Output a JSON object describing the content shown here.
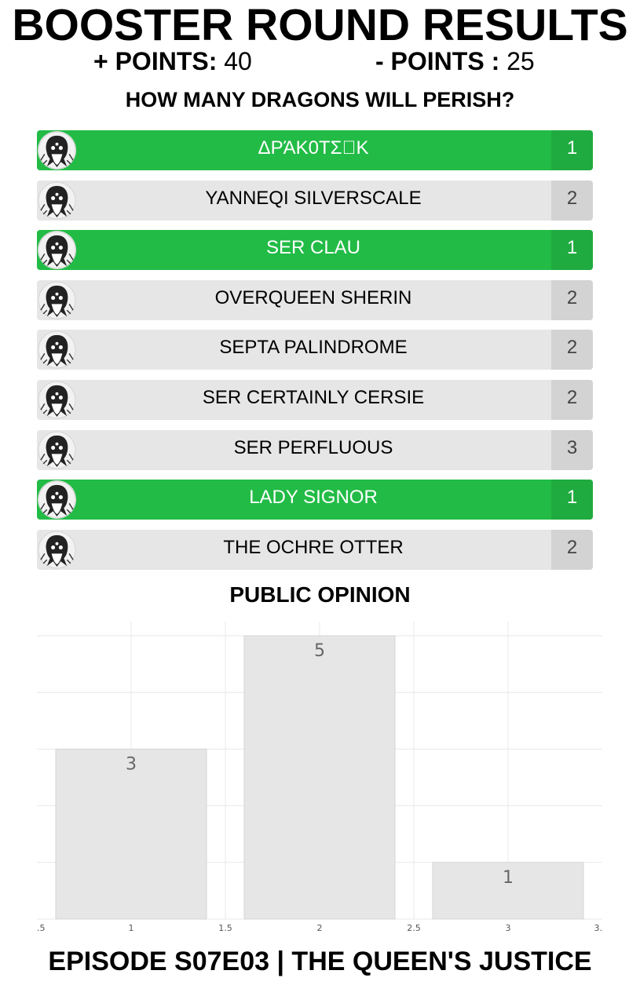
{
  "header": {
    "title": "BOOSTER ROUND RESULTS",
    "plus_label": "+ POINTS:",
    "plus_value": "40",
    "minus_label": "- POINTS :",
    "minus_value": "25",
    "question": "HOW MANY DRAGONS WILL PERISH?"
  },
  "players": [
    {
      "name": "ΔΡΆΚ0ΤΣ⃟Κ",
      "count": "1",
      "correct": true
    },
    {
      "name": "YANNEQI SILVERSCALE",
      "count": "2",
      "correct": false
    },
    {
      "name": "SER CLAU",
      "count": "1",
      "correct": true
    },
    {
      "name": "OVERQUEEN SHERIN",
      "count": "2",
      "correct": false
    },
    {
      "name": "SEPTA PALINDROME",
      "count": "2",
      "correct": false
    },
    {
      "name": "SER CERTAINLY CERSIE",
      "count": "2",
      "correct": false
    },
    {
      "name": "SER PERFLUOUS",
      "count": "3",
      "correct": false
    },
    {
      "name": "LADY SIGNOR",
      "count": "1",
      "correct": true
    },
    {
      "name": "THE OCHRE OTTER",
      "count": "2",
      "correct": false
    }
  ],
  "colors": {
    "correct": "#22bb46",
    "neutral": "#e6e6e6",
    "count_bg": "#d3d3d3",
    "bar": "#e6e6e6"
  },
  "public_opinion": {
    "title": "PUBLIC OPINION"
  },
  "chart_data": {
    "type": "bar",
    "x": [
      1,
      2,
      3
    ],
    "values": [
      3,
      5,
      1
    ],
    "data_labels": [
      "3",
      "5",
      "1"
    ],
    "xlim": [
      0.5,
      3.5
    ],
    "ylim": [
      0,
      5.25
    ],
    "x_ticks": [
      ".5",
      "1",
      "1.5",
      "2",
      "2.5",
      "3",
      "3."
    ],
    "grid": true
  },
  "footer": {
    "episode": "EPISODE S07E03 | THE QUEEN'S JUSTICE"
  }
}
